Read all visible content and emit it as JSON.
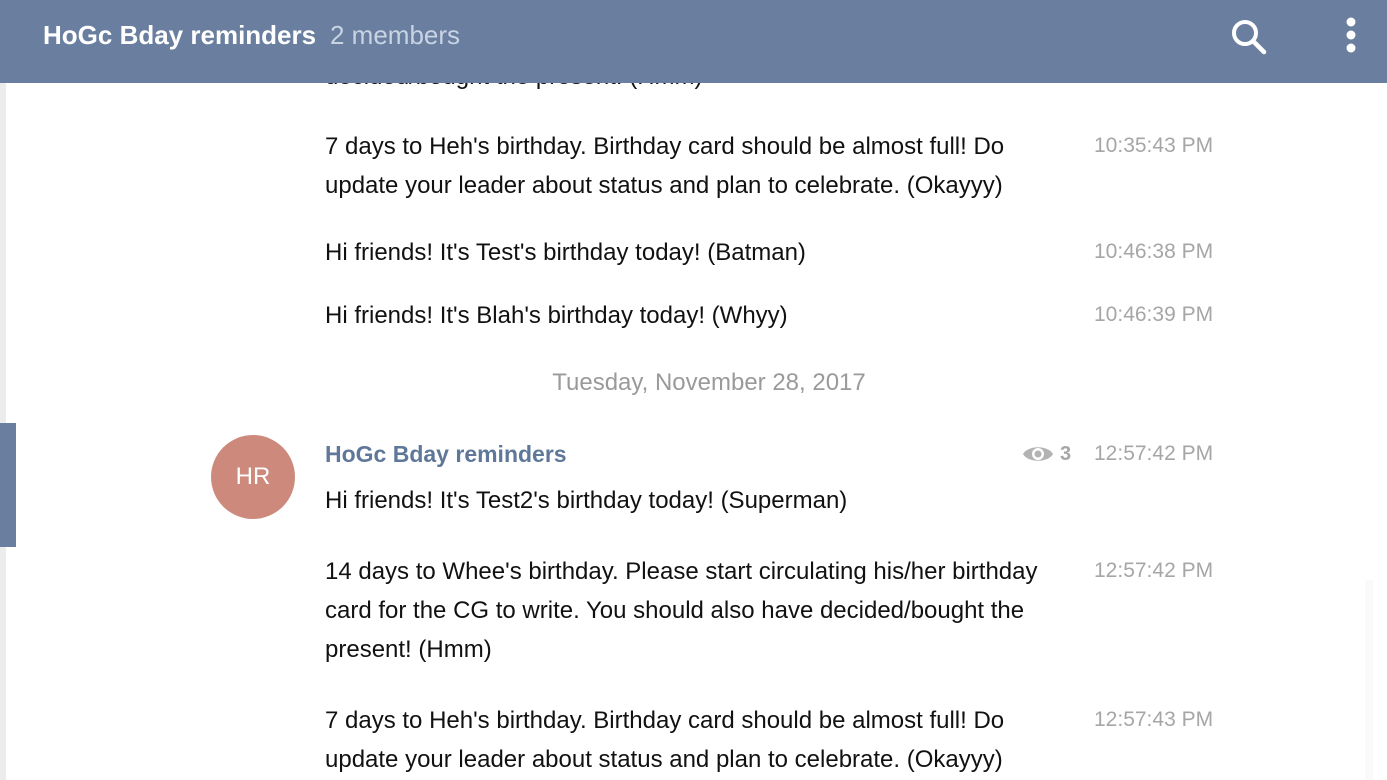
{
  "header": {
    "title": "HoGc Bday reminders",
    "members": "2 members",
    "icons": [
      "search-icon",
      "more-vert-icon"
    ],
    "bg_color": "#6a7f9f"
  },
  "messages_before": [
    {
      "text": "decided/bought the present! (Hmm)",
      "time": ""
    },
    {
      "text": "7 days to Heh's birthday. Birthday card should be almost full! Do update your leader about status and plan to celebrate. (Okayyy)",
      "time": "10:35:43 PM"
    },
    {
      "text": "Hi friends! It's Test's birthday today! (Batman)",
      "time": "10:46:38 PM"
    },
    {
      "text": "Hi friends! It's Blah's birthday today! (Whyy)",
      "time": "10:46:39 PM"
    }
  ],
  "date_separator": "Tuesday, November 28, 2017",
  "group": {
    "avatar_initials": "HR",
    "avatar_color": "#cd8a7c",
    "sender": "HoGc Bday reminders",
    "views": "3",
    "messages": [
      {
        "text": "Hi friends! It's Test2's birthday today! (Superman)",
        "time": "12:57:42 PM"
      },
      {
        "text": "14 days to Whee's birthday. Please start circulating his/her birthday card for the CG to write. You should also have decided/bought the present! (Hmm)",
        "time": "12:57:42 PM"
      },
      {
        "text": "7 days to Heh's birthday. Birthday card should be almost full! Do update your leader about status and plan to celebrate. (Okayyy)",
        "time": "12:57:43 PM"
      }
    ]
  }
}
